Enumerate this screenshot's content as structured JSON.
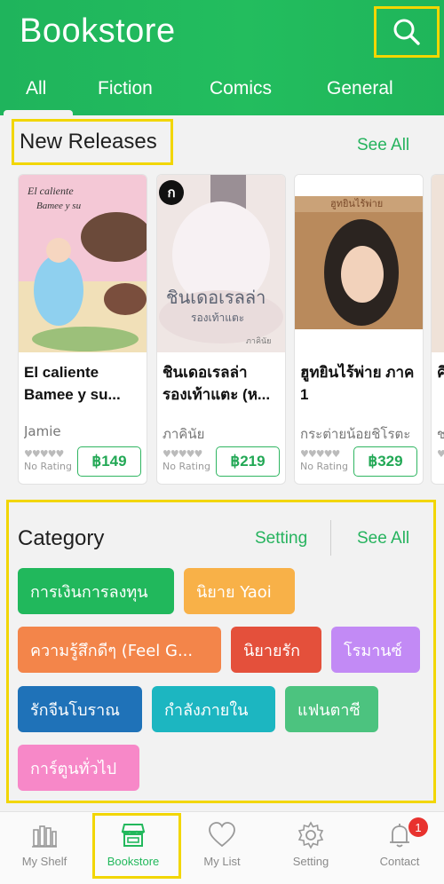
{
  "header": {
    "title": "Bookstore",
    "search_icon": "search-icon",
    "tabs": [
      {
        "label": "All",
        "active": true
      },
      {
        "label": "Fiction"
      },
      {
        "label": "Comics"
      },
      {
        "label": "General"
      }
    ]
  },
  "new_releases": {
    "title": "New Releases",
    "see_all": "See All",
    "books": [
      {
        "title": "El caliente Bamee y su...",
        "author": "Jamie",
        "rating": "No Rating",
        "price": "฿149"
      },
      {
        "title": "ชินเดอเรลล่า รองเท้าแตะ (ห...",
        "author": "ภาคินัย",
        "rating": "No Rating",
        "price": "฿219"
      },
      {
        "title": "ฮูทยินไร้พ่าย ภาค 1",
        "author": "กระต่ายน้อยชิโรตะ",
        "rating": "No Rating",
        "price": "฿329"
      },
      {
        "title": "คิ",
        "author": "ช",
        "rating": "",
        "price": ""
      }
    ]
  },
  "category": {
    "title": "Category",
    "setting": "Setting",
    "see_all": "See All",
    "chips": [
      {
        "label": "การเงินการลงทุน",
        "color": "#21b85c"
      },
      {
        "label": "นิยาย Yaoi",
        "color": "#f8b148"
      },
      {
        "label": "ความรู้สึกดีๆ (Feel G...",
        "color": "#f3854a"
      },
      {
        "label": "นิยายรัก",
        "color": "#e4503b"
      },
      {
        "label": "โรมานซ์",
        "color": "#c28af5"
      },
      {
        "label": "รักจีนโบราณ",
        "color": "#1f72b8"
      },
      {
        "label": "กำลังภายใน",
        "color": "#1cb6c1"
      },
      {
        "label": "แฟนตาซี",
        "color": "#4cc37f"
      },
      {
        "label": "การ์ตูนทั่วไป",
        "color": "#f788c8"
      }
    ]
  },
  "bottom_nav": {
    "items": [
      {
        "label": "My Shelf",
        "icon": "shelf-icon"
      },
      {
        "label": "Bookstore",
        "icon": "store-icon",
        "active": true
      },
      {
        "label": "My List",
        "icon": "heart-icon"
      },
      {
        "label": "Setting",
        "icon": "gear-icon"
      },
      {
        "label": "Contact",
        "icon": "bell-icon",
        "badge": "1"
      }
    ]
  },
  "colors": {
    "brand_green": "#22b85c",
    "highlight": "#f2d600"
  }
}
